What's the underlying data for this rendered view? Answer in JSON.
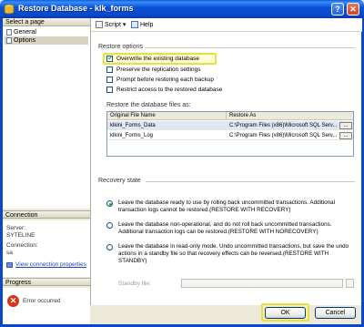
{
  "window": {
    "title": "Restore Database - klk_forms"
  },
  "left_panel": {
    "select_page_header": "Select a page",
    "pages": [
      {
        "label": "General"
      },
      {
        "label": "Options"
      }
    ],
    "connection_header": "Connection",
    "server_label": "Server:",
    "server_value": "SYTELINE",
    "connection_label": "Connection:",
    "connection_value": "sa",
    "view_properties_link": "View connection properties",
    "progress_header": "Progress",
    "progress_status": "Error occurred"
  },
  "toolbar": {
    "script_label": "Script",
    "help_label": "Help"
  },
  "restore_options": {
    "group_label": "Restore options",
    "options": [
      {
        "label": "Overwrite the existing database",
        "checked": true
      },
      {
        "label": "Preserve the replication settings",
        "checked": false
      },
      {
        "label": "Prompt before restoring each backup",
        "checked": false
      },
      {
        "label": "Restrict access to the restored database",
        "checked": false
      }
    ],
    "files_label": "Restore the database files as:",
    "table": {
      "headers": [
        "Original File Name",
        "Restore As"
      ],
      "rows": [
        {
          "original": "klkini_Forms_Data",
          "restore_as": "C:\\Program Files (x86)\\Microsoft SQL Serv..."
        },
        {
          "original": "klkini_Forms_Log",
          "restore_as": "C:\\Program Files (x86)\\Microsoft SQL Serv..."
        }
      ],
      "browse_label": "..."
    }
  },
  "recovery_state": {
    "group_label": "Recovery state",
    "options": [
      {
        "text": "Leave the database ready to use by rolling back uncommitted transactions. Additional transaction logs cannot be restored.(RESTORE WITH RECOVERY)",
        "selected": true
      },
      {
        "text": "Leave the database non-operational, and do not roll back uncommitted transactions. Additional transaction logs can be restored.(RESTORE WITH NORECOVERY)",
        "selected": false
      },
      {
        "text": "Leave the database in read-only mode. Undo uncommitted transactions, but save the undo actions in a standby file so that recovery effects can be reversed.(RESTORE WITH STANDBY)",
        "selected": false
      }
    ],
    "standby_label": "Standby file:",
    "standby_value": ""
  },
  "buttons": {
    "ok_label": "OK",
    "cancel_label": "Cancel"
  }
}
